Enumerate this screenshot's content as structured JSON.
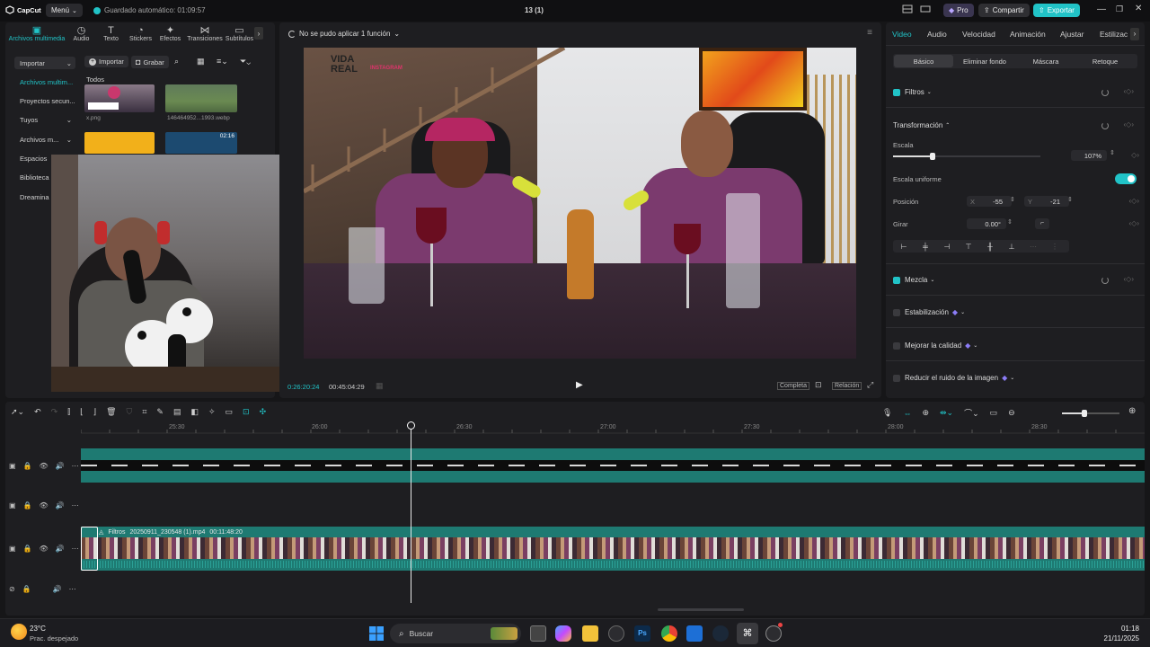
{
  "app": {
    "logo": "CapCut",
    "menu_label": "Menú",
    "autosave": "Guardado automático: 01:09:57",
    "project_title": "13 (1)",
    "pro_label": "Pro",
    "share_label": "Compartir",
    "export_label": "Exportar"
  },
  "media_tabs": [
    {
      "label": "Archivos multimedia",
      "icon": "media-icon"
    },
    {
      "label": "Audio",
      "icon": "audio-icon"
    },
    {
      "label": "Texto",
      "icon": "text-icon"
    },
    {
      "label": "Stickers",
      "icon": "sticker-icon"
    },
    {
      "label": "Efectos",
      "icon": "effects-icon"
    },
    {
      "label": "Transiciones",
      "icon": "transitions-icon"
    },
    {
      "label": "Subtítulos",
      "icon": "subtitles-icon"
    }
  ],
  "sidebar": {
    "items": [
      "Importar",
      "Archivos multim...",
      "Proyectos secun...",
      "Tuyos",
      "Archivos m...",
      "Espacios",
      "Biblioteca",
      "Dreamina"
    ]
  },
  "media_toolbar": {
    "import_label": "Importar",
    "record_label": "Grabar",
    "all_label": "Todos"
  },
  "media_items": [
    {
      "name": "x.png"
    },
    {
      "name": "146464952...1993.webp"
    },
    {
      "name": "",
      "badge": ""
    },
    {
      "name": "",
      "duration": "02:16"
    }
  ],
  "preview": {
    "status": "No se pudo aplicar 1 función",
    "current_time": "0:26:20:24",
    "total_time": "00:45:04:29",
    "full_label": "Completa",
    "ratio_label": "Relación",
    "watermark_line1": "VIDA",
    "watermark_line2": "REAL",
    "watermark_tag": "INSTAGRAM"
  },
  "inspector": {
    "tabs": [
      "Video",
      "Audio",
      "Velocidad",
      "Animación",
      "Ajustar",
      "Estilizac"
    ],
    "subtabs": [
      "Básico",
      "Eliminar fondo",
      "Máscara",
      "Retoque"
    ],
    "filters_label": "Filtros",
    "transform_label": "Transformación",
    "scale_label": "Escala",
    "scale_value": "107%",
    "scale_fraction": 0.27,
    "uniform_scale_label": "Escala uniforme",
    "position_label": "Posición",
    "pos_x_label": "X",
    "pos_x_value": "-55",
    "pos_y_label": "Y",
    "pos_y_value": "-21",
    "rotate_label": "Girar",
    "rotate_value": "0.00°",
    "blend_label": "Mezcla",
    "stabilize_label": "Estabilización",
    "quality_label": "Mejorar la calidad",
    "denoise_label": "Reducir el ruido de la imagen"
  },
  "timeline": {
    "ruler": [
      "25:30",
      "26:00",
      "26:30",
      "27:00",
      "27:30",
      "28:00",
      "28:30"
    ],
    "clip_label": "Filtros",
    "clip_file": "20250911_230548 (1).mp4",
    "clip_duration": "00:11:48:20"
  },
  "taskbar": {
    "temp": "23°C",
    "weather": "Prac. despejado",
    "search_placeholder": "Buscar",
    "time": "01:18",
    "date": "21/11/2025"
  },
  "colors": {
    "accent": "#21c3c7",
    "track_teal": "#1e7a72",
    "background": "#161618",
    "panel": "#1e1e21"
  }
}
